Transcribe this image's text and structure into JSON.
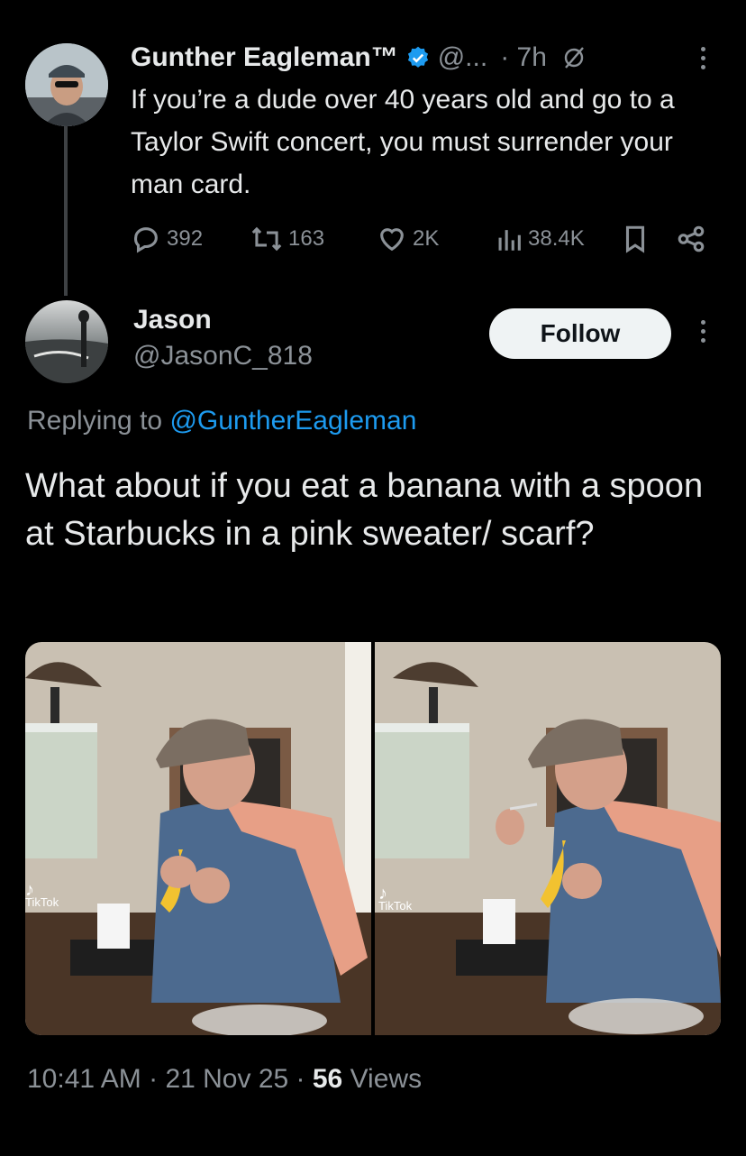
{
  "original_tweet": {
    "author_name": "Gunther Eagleman™",
    "handle": "@...",
    "time": "· 7h",
    "text": "If you’re a dude over 40 years old and go to a Taylor Swift concert,  you must surrender your man card.",
    "replies": "392",
    "retweets": "163",
    "likes": "2K",
    "views": "38.4K"
  },
  "reply": {
    "author_name": "Jason",
    "handle": "@JasonC_818",
    "follow_label": "Follow",
    "replying_prefix": "Replying to ",
    "replying_handle": "@GuntherEagleman",
    "text": "What about if you eat a banana with a spoon at Starbucks in a pink sweater/ scarf?",
    "media_watermark": "TikTok",
    "footer_time": "10:41 AM",
    "footer_sep1": " · ",
    "footer_date": "21 Nov 25",
    "footer_sep2": " · ",
    "footer_views_count": "56",
    "footer_views_label": " Views"
  },
  "colors": {
    "background": "#000000",
    "text_primary": "#e7e9ea",
    "text_muted": "#8b9197",
    "link": "#1d9bf0",
    "verified": "#1d9bf0",
    "follow_bg": "#eff3f4"
  },
  "icons": [
    "verified-badge-icon",
    "grok-icon",
    "more-icon",
    "reply-icon",
    "retweet-icon",
    "like-icon",
    "views-icon",
    "bookmark-icon",
    "share-icon",
    "tiktok-icon"
  ]
}
